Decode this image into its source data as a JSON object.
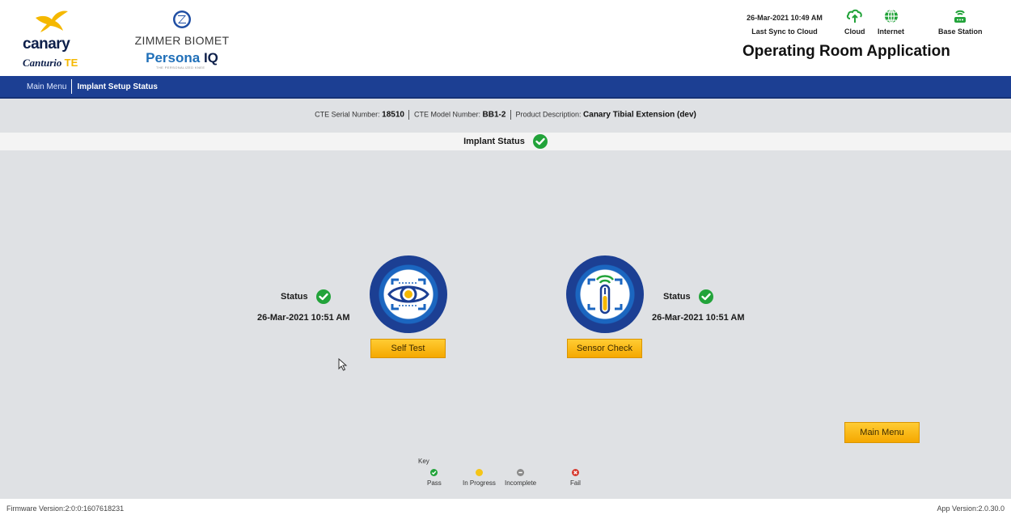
{
  "header": {
    "canary_logo": "canary",
    "canurio_logo": "Canturio",
    "canurio_te": "TE",
    "zimmer_logo": "ZIMMER BIOMET",
    "persona_logo": "Persona",
    "persona_iq": "IQ",
    "persona_tagline": "THE PERSONALIZED KNEE",
    "sync_date": "26-Mar-2021 10:49 AM",
    "sync_label": "Last Sync to Cloud",
    "cloud_label": "Cloud",
    "internet_label": "Internet",
    "base_station_label": "Base Station",
    "app_title": "Operating Room Application"
  },
  "nav": {
    "main_menu": "Main Menu",
    "current": "Implant Setup Status"
  },
  "serial": {
    "serial_label": "CTE Serial Number:",
    "serial_value": "18510",
    "model_label": "CTE Model Number:",
    "model_value": "BB1-2",
    "product_label": "Product Description:",
    "product_value": "Canary Tibial Extension (dev)"
  },
  "implant_status": {
    "label": "Implant Status",
    "state": "pass"
  },
  "self_test": {
    "status_label": "Status",
    "state": "pass",
    "date": "26-Mar-2021 10:51 AM",
    "button": "Self Test",
    "icon": "eye-scan-icon"
  },
  "sensor_check": {
    "status_label": "Status",
    "state": "pass",
    "date": "26-Mar-2021 10:51 AM",
    "button": "Sensor Check",
    "icon": "sensor-signal-icon"
  },
  "main_menu_button": "Main Menu",
  "key": {
    "title": "Key",
    "items": [
      {
        "label": "Pass",
        "color": "#22a33a"
      },
      {
        "label": "In Progress",
        "color": "#f5c518"
      },
      {
        "label": "Incomplete",
        "color": "#8a8a8a"
      },
      {
        "label": "Fail",
        "color": "#d63a2f"
      }
    ]
  },
  "footer": {
    "firmware": "Firmware Version:2:0:0:1607618231",
    "app_version": "App Version:2.0.30.0"
  },
  "colors": {
    "nav_blue": "#1c3f93",
    "button_yellow": "#f5a800",
    "pass_green": "#22a33a",
    "panel_gray": "#dfe1e4"
  }
}
